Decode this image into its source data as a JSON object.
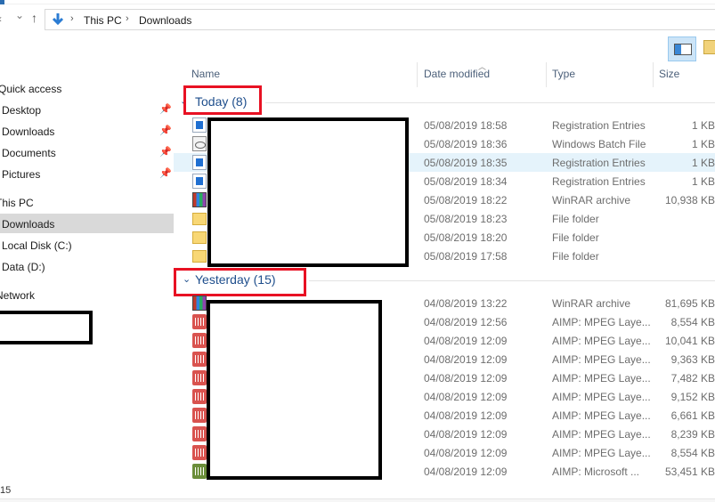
{
  "breadcrumb": {
    "items": [
      "This PC",
      "Downloads"
    ]
  },
  "nav_buttons": {
    "back": "‹",
    "dropdown": "⌄",
    "up": "↑"
  },
  "sidebar": {
    "items": [
      {
        "label": "Quick access",
        "pinned": false,
        "selected": false,
        "icon": "star-icon"
      },
      {
        "label": "Desktop",
        "pinned": true,
        "selected": false,
        "icon": "desktop-icon"
      },
      {
        "label": "Downloads",
        "pinned": true,
        "selected": false,
        "icon": "download-icon"
      },
      {
        "label": "Documents",
        "pinned": true,
        "selected": false,
        "icon": "document-icon"
      },
      {
        "label": "Pictures",
        "pinned": true,
        "selected": false,
        "icon": "picture-icon"
      },
      {
        "label": "This PC",
        "pinned": false,
        "selected": false,
        "icon": "computer-icon"
      },
      {
        "label": "Downloads",
        "pinned": false,
        "selected": true,
        "icon": "download-icon"
      },
      {
        "label": "Local Disk (C:)",
        "pinned": false,
        "selected": false,
        "icon": "drive-icon"
      },
      {
        "label": "Data (D:)",
        "pinned": false,
        "selected": false,
        "icon": "drive-icon"
      },
      {
        "label": "Network",
        "pinned": false,
        "selected": false,
        "icon": "network-icon"
      }
    ],
    "pin_glyph": "📌"
  },
  "columns": {
    "name": "Name",
    "date": "Date modified",
    "type": "Type",
    "size": "Size"
  },
  "groups": [
    {
      "title": "Today (8)",
      "rows": [
        {
          "date": "05/08/2019 18:58",
          "type": "Registration Entries",
          "size": "1 KB",
          "icon": "reg-file-icon"
        },
        {
          "date": "05/08/2019 18:36",
          "type": "Windows Batch File",
          "size": "1 KB",
          "icon": "batch-file-icon"
        },
        {
          "date": "05/08/2019 18:35",
          "type": "Registration Entries",
          "size": "1 KB",
          "icon": "reg-file-icon",
          "highlighted": true
        },
        {
          "date": "05/08/2019 18:34",
          "type": "Registration Entries",
          "size": "1 KB",
          "icon": "reg-file-icon"
        },
        {
          "date": "05/08/2019 18:22",
          "type": "WinRAR archive",
          "size": "10,938 KB",
          "icon": "winrar-icon"
        },
        {
          "date": "05/08/2019 18:23",
          "type": "File folder",
          "size": "",
          "icon": "folder-icon"
        },
        {
          "date": "05/08/2019 18:20",
          "type": "File folder",
          "size": "",
          "icon": "folder-icon"
        },
        {
          "date": "05/08/2019 17:58",
          "type": "File folder",
          "size": "",
          "icon": "folder-icon"
        }
      ]
    },
    {
      "title": "Yesterday (15)",
      "rows": [
        {
          "date": "04/08/2019 13:22",
          "type": "WinRAR archive",
          "size": "81,695 KB",
          "icon": "winrar-icon"
        },
        {
          "date": "04/08/2019 12:56",
          "type": "AIMP: MPEG Laye...",
          "size": "8,554 KB",
          "icon": "aimp-audio-icon"
        },
        {
          "date": "04/08/2019 12:09",
          "type": "AIMP: MPEG Laye...",
          "size": "10,041 KB",
          "icon": "aimp-audio-icon"
        },
        {
          "date": "04/08/2019 12:09",
          "type": "AIMP: MPEG Laye...",
          "size": "9,363 KB",
          "icon": "aimp-audio-icon"
        },
        {
          "date": "04/08/2019 12:09",
          "type": "AIMP: MPEG Laye...",
          "size": "7,482 KB",
          "icon": "aimp-audio-icon"
        },
        {
          "date": "04/08/2019 12:09",
          "type": "AIMP: MPEG Laye...",
          "size": "9,152 KB",
          "icon": "aimp-audio-icon"
        },
        {
          "date": "04/08/2019 12:09",
          "type": "AIMP: MPEG Laye...",
          "size": "6,661 KB",
          "icon": "aimp-audio-icon"
        },
        {
          "date": "04/08/2019 12:09",
          "type": "AIMP: MPEG Laye...",
          "size": "8,239 KB",
          "icon": "aimp-audio-icon"
        },
        {
          "date": "04/08/2019 12:09",
          "type": "AIMP: MPEG Laye...",
          "size": "8,554 KB",
          "icon": "aimp-audio-icon"
        },
        {
          "date": "04/08/2019 12:09",
          "type": "AIMP: Microsoft ...",
          "size": "53,451 KB",
          "icon": "aimp-audio-icon-green"
        }
      ]
    }
  ],
  "status": {
    "text": "15"
  },
  "colors": {
    "group_header": "#1e4e8c",
    "highlight_box": "#e81123",
    "selection": "#e5f3fb",
    "sidebar_selected": "#d9d9d9"
  }
}
